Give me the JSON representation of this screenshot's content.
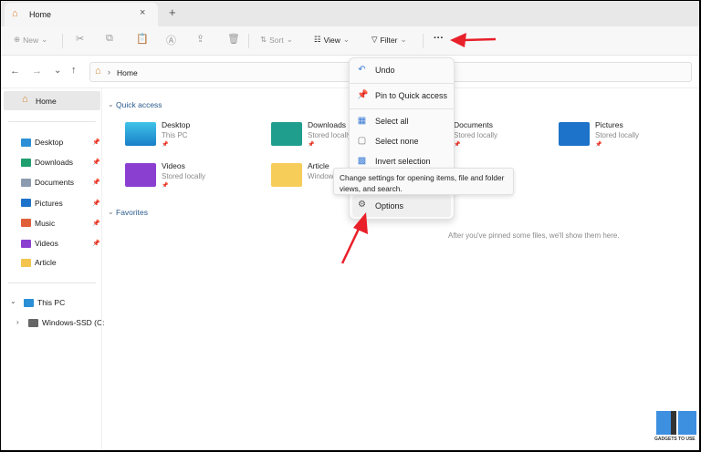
{
  "tab": {
    "title": "Home",
    "close": "×",
    "new": "+"
  },
  "toolbar": {
    "new": "New",
    "sort": "Sort",
    "view": "View",
    "filter": "Filter",
    "more": "···"
  },
  "address": {
    "path": "Home"
  },
  "sidebar": {
    "home": "Home",
    "pinned": [
      {
        "label": "Desktop",
        "color": "#2a8fd6"
      },
      {
        "label": "Downloads",
        "color": "#1f9e6e"
      },
      {
        "label": "Documents",
        "color": "#8c9bb0"
      },
      {
        "label": "Pictures",
        "color": "#1d72c9"
      },
      {
        "label": "Music",
        "color": "#e0603a"
      },
      {
        "label": "Videos",
        "color": "#8b3fd0"
      }
    ],
    "article": "Article",
    "thispc": "This PC",
    "drive": "Windows-SSD (C:"
  },
  "content": {
    "quick_access": "Quick access",
    "favorites": "Favorites",
    "empty": "After you've pinned some files, we'll show them here.",
    "items": [
      {
        "name": "Desktop",
        "sub": "This PC"
      },
      {
        "name": "Downloads",
        "sub": "Stored locally"
      },
      {
        "name": "Documents",
        "sub": "Stored locally"
      },
      {
        "name": "Pictures",
        "sub": "Stored locally"
      },
      {
        "name": "Videos",
        "sub": "Stored locally"
      },
      {
        "name": "Article",
        "sub": "Windows"
      }
    ]
  },
  "menu": {
    "undo": "Undo",
    "pin": "Pin to Quick access",
    "select_all": "Select all",
    "select_none": "Select none",
    "invert": "Invert selection",
    "options": "Options"
  },
  "tooltip": "Change settings for opening items, file and folder views, and search.",
  "watermark": "GADGETS TO USE",
  "colors": {
    "accent": "#3a7bd5",
    "arrow": "#e8202a"
  }
}
